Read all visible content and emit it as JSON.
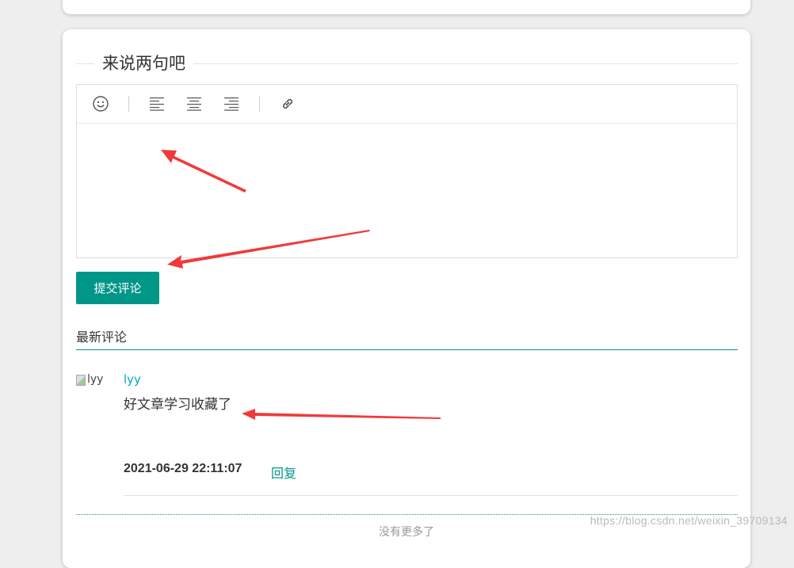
{
  "comment_section": {
    "title": "来说两句吧",
    "toolbar": {
      "tools": [
        {
          "icon": "emoji-icon"
        },
        {
          "icon": "align-left-icon"
        },
        {
          "icon": "align-center-icon"
        },
        {
          "icon": "align-right-icon"
        },
        {
          "icon": "link-icon"
        }
      ]
    },
    "editor_value": "",
    "submit_label": "提交评论"
  },
  "latest": {
    "title": "最新评论",
    "comments": [
      {
        "avatar_alt": "lyy",
        "user": "lyy",
        "text": "好文章学习收藏了",
        "time": "2021-06-29 22:11:07",
        "reply_label": "回复"
      }
    ],
    "no_more": "没有更多了"
  },
  "watermark": "https://blog.csdn.net/weixin_39709134",
  "colors": {
    "accent": "#009688",
    "link": "#00a6c8",
    "annotation_arrow": "#f03a3a"
  }
}
